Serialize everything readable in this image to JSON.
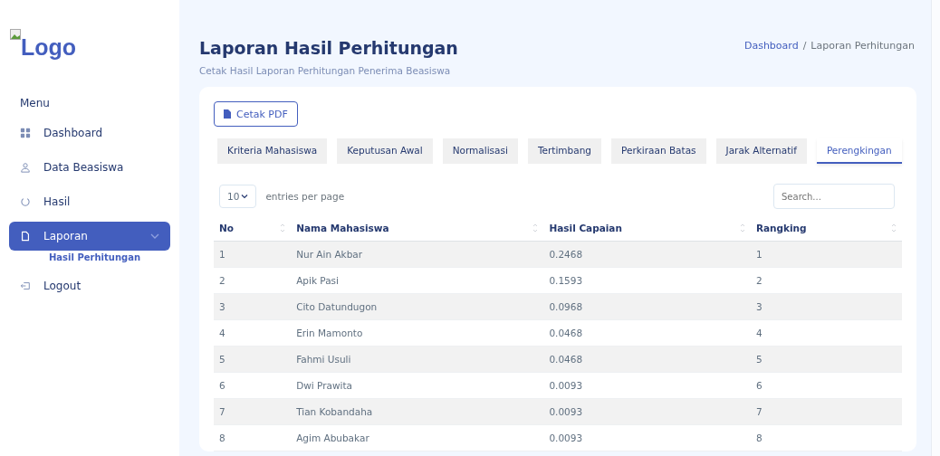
{
  "sidebar": {
    "logo": "Logo",
    "menu_heading": "Menu",
    "items": [
      {
        "label": "Dashboard",
        "selected": false
      },
      {
        "label": "Data Beasiswa",
        "selected": false
      },
      {
        "label": "Hasil",
        "selected": false
      },
      {
        "label": "Laporan",
        "selected": true,
        "expanded": true,
        "children": [
          {
            "label": "Hasil Perhitungan"
          }
        ]
      },
      {
        "label": "Logout",
        "selected": false
      }
    ]
  },
  "header": {
    "title": "Laporan Hasil Perhitungan",
    "subtitle": "Cetak Hasil Laporan Perhitungan Penerima Beasiswa",
    "breadcrumb": [
      {
        "label": "Dashboard",
        "kind": "link"
      },
      {
        "label": "/",
        "kind": "separator"
      },
      {
        "label": "Laporan Perhitungan",
        "kind": "current"
      }
    ]
  },
  "card": {
    "button": "Cetak PDF",
    "tabs": [
      {
        "label": "Kriteria Mahasiswa",
        "selected": false
      },
      {
        "label": "Keputusan Awal",
        "selected": false
      },
      {
        "label": "Normalisasi",
        "selected": false
      },
      {
        "label": "Tertimbang",
        "selected": false
      },
      {
        "label": "Perkiraan Batas",
        "selected": false
      },
      {
        "label": "Jarak Alternatif",
        "selected": false
      },
      {
        "label": "Perengkingan",
        "selected": true
      }
    ],
    "entries": {
      "value": "10",
      "label": "entries per page"
    },
    "search": {
      "placeholder": "Search..."
    },
    "table": {
      "columns": [
        "No",
        "Nama Mahasiswa",
        "Hasil Capaian",
        "Rangking"
      ],
      "rows": [
        [
          "1",
          "Nur Ain Akbar",
          "0.2468",
          "1"
        ],
        [
          "2",
          "Apik Pasi",
          "0.1593",
          "2"
        ],
        [
          "3",
          "Cito Datundugon",
          "0.0968",
          "3"
        ],
        [
          "4",
          "Erin Mamonto",
          "0.0468",
          "4"
        ],
        [
          "5",
          "Fahmi Usuli",
          "0.0468",
          "5"
        ],
        [
          "6",
          "Dwi Prawita",
          "0.0093",
          "6"
        ],
        [
          "7",
          "Tian Kobandaha",
          "0.0093",
          "7"
        ],
        [
          "8",
          "Agim Abubakar",
          "0.0093",
          "8"
        ]
      ]
    }
  }
}
